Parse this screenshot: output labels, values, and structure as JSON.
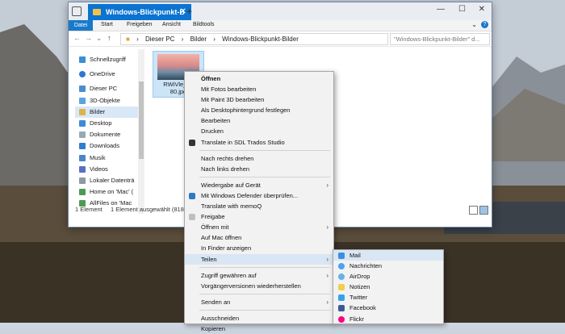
{
  "window": {
    "tab_title": "Windows-Blickpunkt-B",
    "plus": "+",
    "controls": [
      "—",
      "☐",
      "✕"
    ]
  },
  "ribbon": {
    "tabs": [
      "Datei",
      "Start",
      "Freigeben",
      "Ansicht",
      "Bildtools"
    ],
    "help": "?"
  },
  "address": {
    "path": [
      "Dieser PC",
      "Bilder",
      "Windows-Blickpunkt-Bilder"
    ],
    "search_placeholder": "\"Windows-Blickpunkt-Bilder\" d..."
  },
  "nav_pane": {
    "items": [
      "Schnellzugriff",
      "OneDrive",
      "Dieser PC",
      "3D-Objekte",
      "Bilder",
      "Desktop",
      "Dokumente",
      "Downloads",
      "Musik",
      "Videos",
      "Lokaler Datenträ",
      "Home on 'Mac' (",
      "AllFiles on 'Mac"
    ],
    "selected_index": 4
  },
  "file": {
    "name_line1": "RWiVle_19",
    "name_line2": "80.jpg"
  },
  "status": {
    "count": "1 Element",
    "selection": "1 Element ausgewählt (818 K"
  },
  "context_menu": {
    "group1": [
      "Öffnen",
      "Mit Fotos bearbeiten",
      "Mit Paint 3D bearbeiten",
      "Als Desktophintergrund festlegen",
      "Bearbeiten",
      "Drucken",
      "Translate in SDL Trados Studio"
    ],
    "group2": [
      "Nach rechts drehen",
      "Nach links drehen"
    ],
    "group3": [
      "Wiedergabe auf Gerät",
      "Mit Windows Defender überprüfen...",
      "Translate with memoQ",
      "Freigabe",
      "Öffnen mit",
      "Auf Mac öffnen",
      "In Finder anzeigen",
      "Teilen"
    ],
    "group4": [
      "Zugriff gewähren auf",
      "Vorgängerversionen wiederherstellen"
    ],
    "group5": [
      "Senden an"
    ],
    "group6": [
      "Ausschneiden",
      "Kopieren"
    ]
  },
  "share_submenu": {
    "items": [
      "Mail",
      "Nachrichten",
      "AirDrop",
      "Notizen",
      "Twitter",
      "Facebook",
      "Flickr"
    ]
  },
  "colors": {
    "accent": "#0b73d1",
    "highlight": "#d9e6f3",
    "folder": "#f2c24b"
  }
}
